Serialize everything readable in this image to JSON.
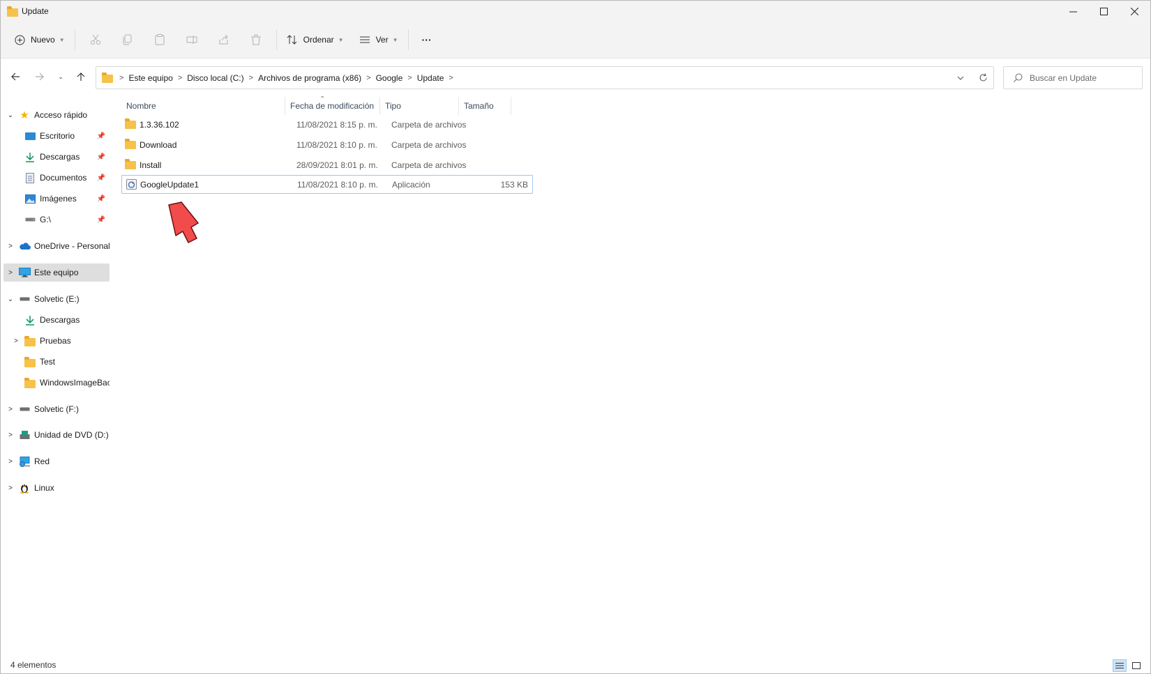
{
  "window": {
    "title": "Update"
  },
  "toolbar": {
    "new_label": "Nuevo",
    "sort_label": "Ordenar",
    "view_label": "Ver",
    "more_label": "···"
  },
  "breadcrumb": [
    "Este equipo",
    "Disco local (C:)",
    "Archivos de programa (x86)",
    "Google",
    "Update"
  ],
  "search": {
    "placeholder": "Buscar en Update"
  },
  "sidebar": {
    "items": [
      {
        "label": "Acceso rápido",
        "icon": "star-icon"
      },
      {
        "label": "Escritorio",
        "icon": "desktop-icon"
      },
      {
        "label": "Descargas",
        "icon": "download-icon"
      },
      {
        "label": "Documentos",
        "icon": "document-icon"
      },
      {
        "label": "Imágenes",
        "icon": "image-icon"
      },
      {
        "label": "G:\\",
        "icon": "drive-icon"
      },
      {
        "label": "OneDrive - Personal",
        "icon": "cloud-icon"
      },
      {
        "label": "Este equipo",
        "icon": "computer-icon"
      },
      {
        "label": "Solvetic (E:)",
        "icon": "drive-icon"
      },
      {
        "label": "Descargas",
        "icon": "download-icon"
      },
      {
        "label": "Pruebas",
        "icon": "folder-icon"
      },
      {
        "label": "Test",
        "icon": "folder-icon"
      },
      {
        "label": "WindowsImageBackup",
        "icon": "folder-icon"
      },
      {
        "label": "Solvetic (F:)",
        "icon": "drive-icon"
      },
      {
        "label": "Unidad de DVD (D:)",
        "icon": "dvd-icon"
      },
      {
        "label": "Red",
        "icon": "network-icon"
      },
      {
        "label": "Linux",
        "icon": "linux-icon"
      }
    ]
  },
  "columns": {
    "name": "Nombre",
    "date": "Fecha de modificación",
    "type": "Tipo",
    "size": "Tamaño"
  },
  "files": [
    {
      "name": "1.3.36.102",
      "date": "11/08/2021 8:15 p. m.",
      "type": "Carpeta de archivos",
      "size": "",
      "icon": "folder-icon"
    },
    {
      "name": "Download",
      "date": "11/08/2021 8:10 p. m.",
      "type": "Carpeta de archivos",
      "size": "",
      "icon": "folder-icon"
    },
    {
      "name": "Install",
      "date": "28/09/2021 8:01 p. m.",
      "type": "Carpeta de archivos",
      "size": "",
      "icon": "folder-icon"
    },
    {
      "name": "GoogleUpdate1",
      "date": "11/08/2021 8:10 p. m.",
      "type": "Aplicación",
      "size": "153 KB",
      "icon": "application-icon"
    }
  ],
  "status": {
    "item_count": "4 elementos"
  },
  "colors": {
    "selection_border": "#9cc8ef",
    "folder": "#f6c24a",
    "arrow": "#f24b4b"
  }
}
